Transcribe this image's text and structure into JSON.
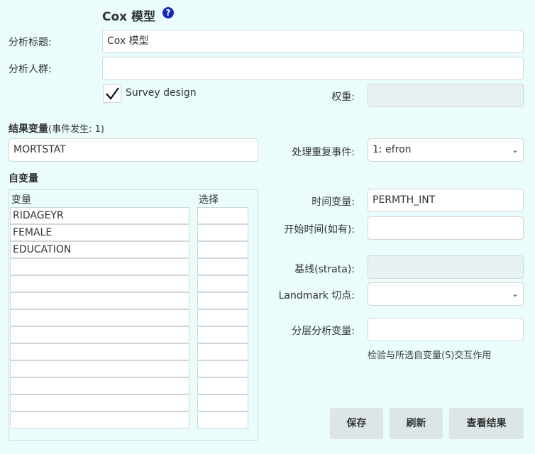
{
  "header": {
    "title": "Cox 模型",
    "help_icon": "?"
  },
  "form": {
    "analysis_title_label": "分析标题:",
    "analysis_title_value": "Cox 模型",
    "population_label": "分析人群:",
    "population_value": "",
    "survey_design_label": "Survey design",
    "survey_design_checked": true,
    "weight_label": "权重:",
    "weight_value": ""
  },
  "outcome": {
    "label": "结果变量",
    "event_note": "(事件发生: 1)",
    "value": "MORTSTAT",
    "ties_label": "处理重复事件:",
    "ties_value": "1: efron"
  },
  "predictors": {
    "label": "自变量",
    "col_variable": "变量",
    "col_select": "选择",
    "rows": [
      "RIDAGEYR",
      "FEMALE",
      "EDUCATION",
      "",
      "",
      "",
      "",
      "",
      "",
      "",
      "",
      "",
      ""
    ]
  },
  "time": {
    "time_var_label": "时间变量:",
    "time_var_value": "PERMTH_INT",
    "start_time_label": "开始时间(如有):",
    "start_time_value": "",
    "strata_label": "基线(strata):",
    "strata_value": "",
    "landmark_label": "Landmark 切点:",
    "landmark_value": "",
    "subgroup_label": "分层分析变量:",
    "subgroup_value": "",
    "subgroup_note": "检验与所选自变量(S)交互作用"
  },
  "buttons": {
    "save": "保存",
    "refresh": "刷新",
    "view_results": "查看结果"
  }
}
